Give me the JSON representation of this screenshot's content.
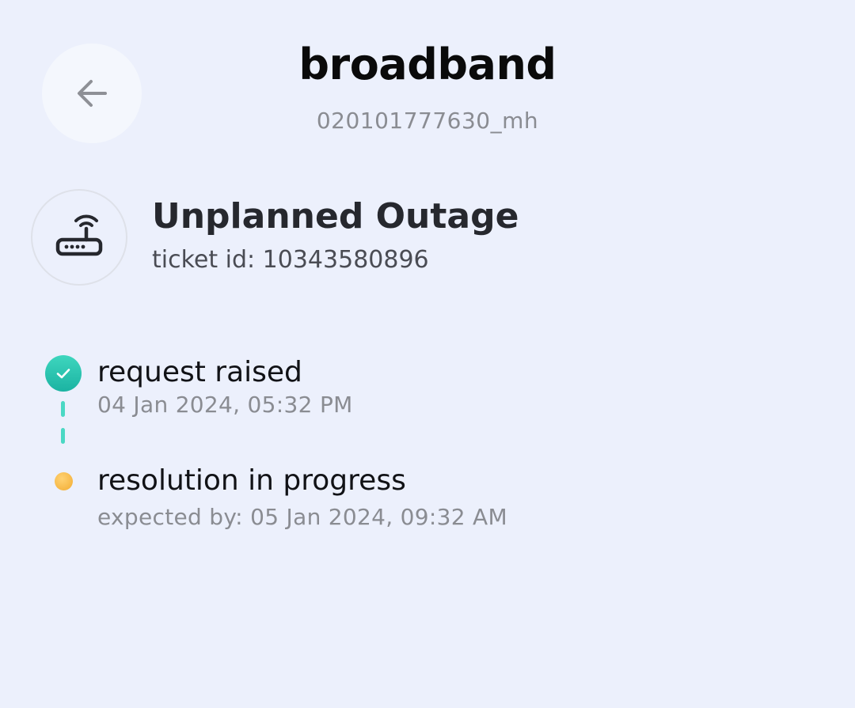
{
  "header": {
    "title": "broadband",
    "subtitle": "020101777630_mh",
    "back_icon": "arrow-left-icon"
  },
  "ticket": {
    "icon": "router-icon",
    "title": "Unplanned Outage",
    "id_text": "ticket id: 10343580896"
  },
  "timeline": [
    {
      "status": "done",
      "icon": "check-circle-icon",
      "label": "request raised",
      "detail": "04 Jan 2024, 05:32 PM"
    },
    {
      "status": "in-progress",
      "icon": "pending-dot-icon",
      "label": "resolution in progress",
      "detail": "expected by: 05 Jan 2024, 09:32 AM"
    }
  ],
  "colors": {
    "background": "#ECF0FC",
    "done": "#2CC6B0",
    "pending": "#F5B23C"
  }
}
